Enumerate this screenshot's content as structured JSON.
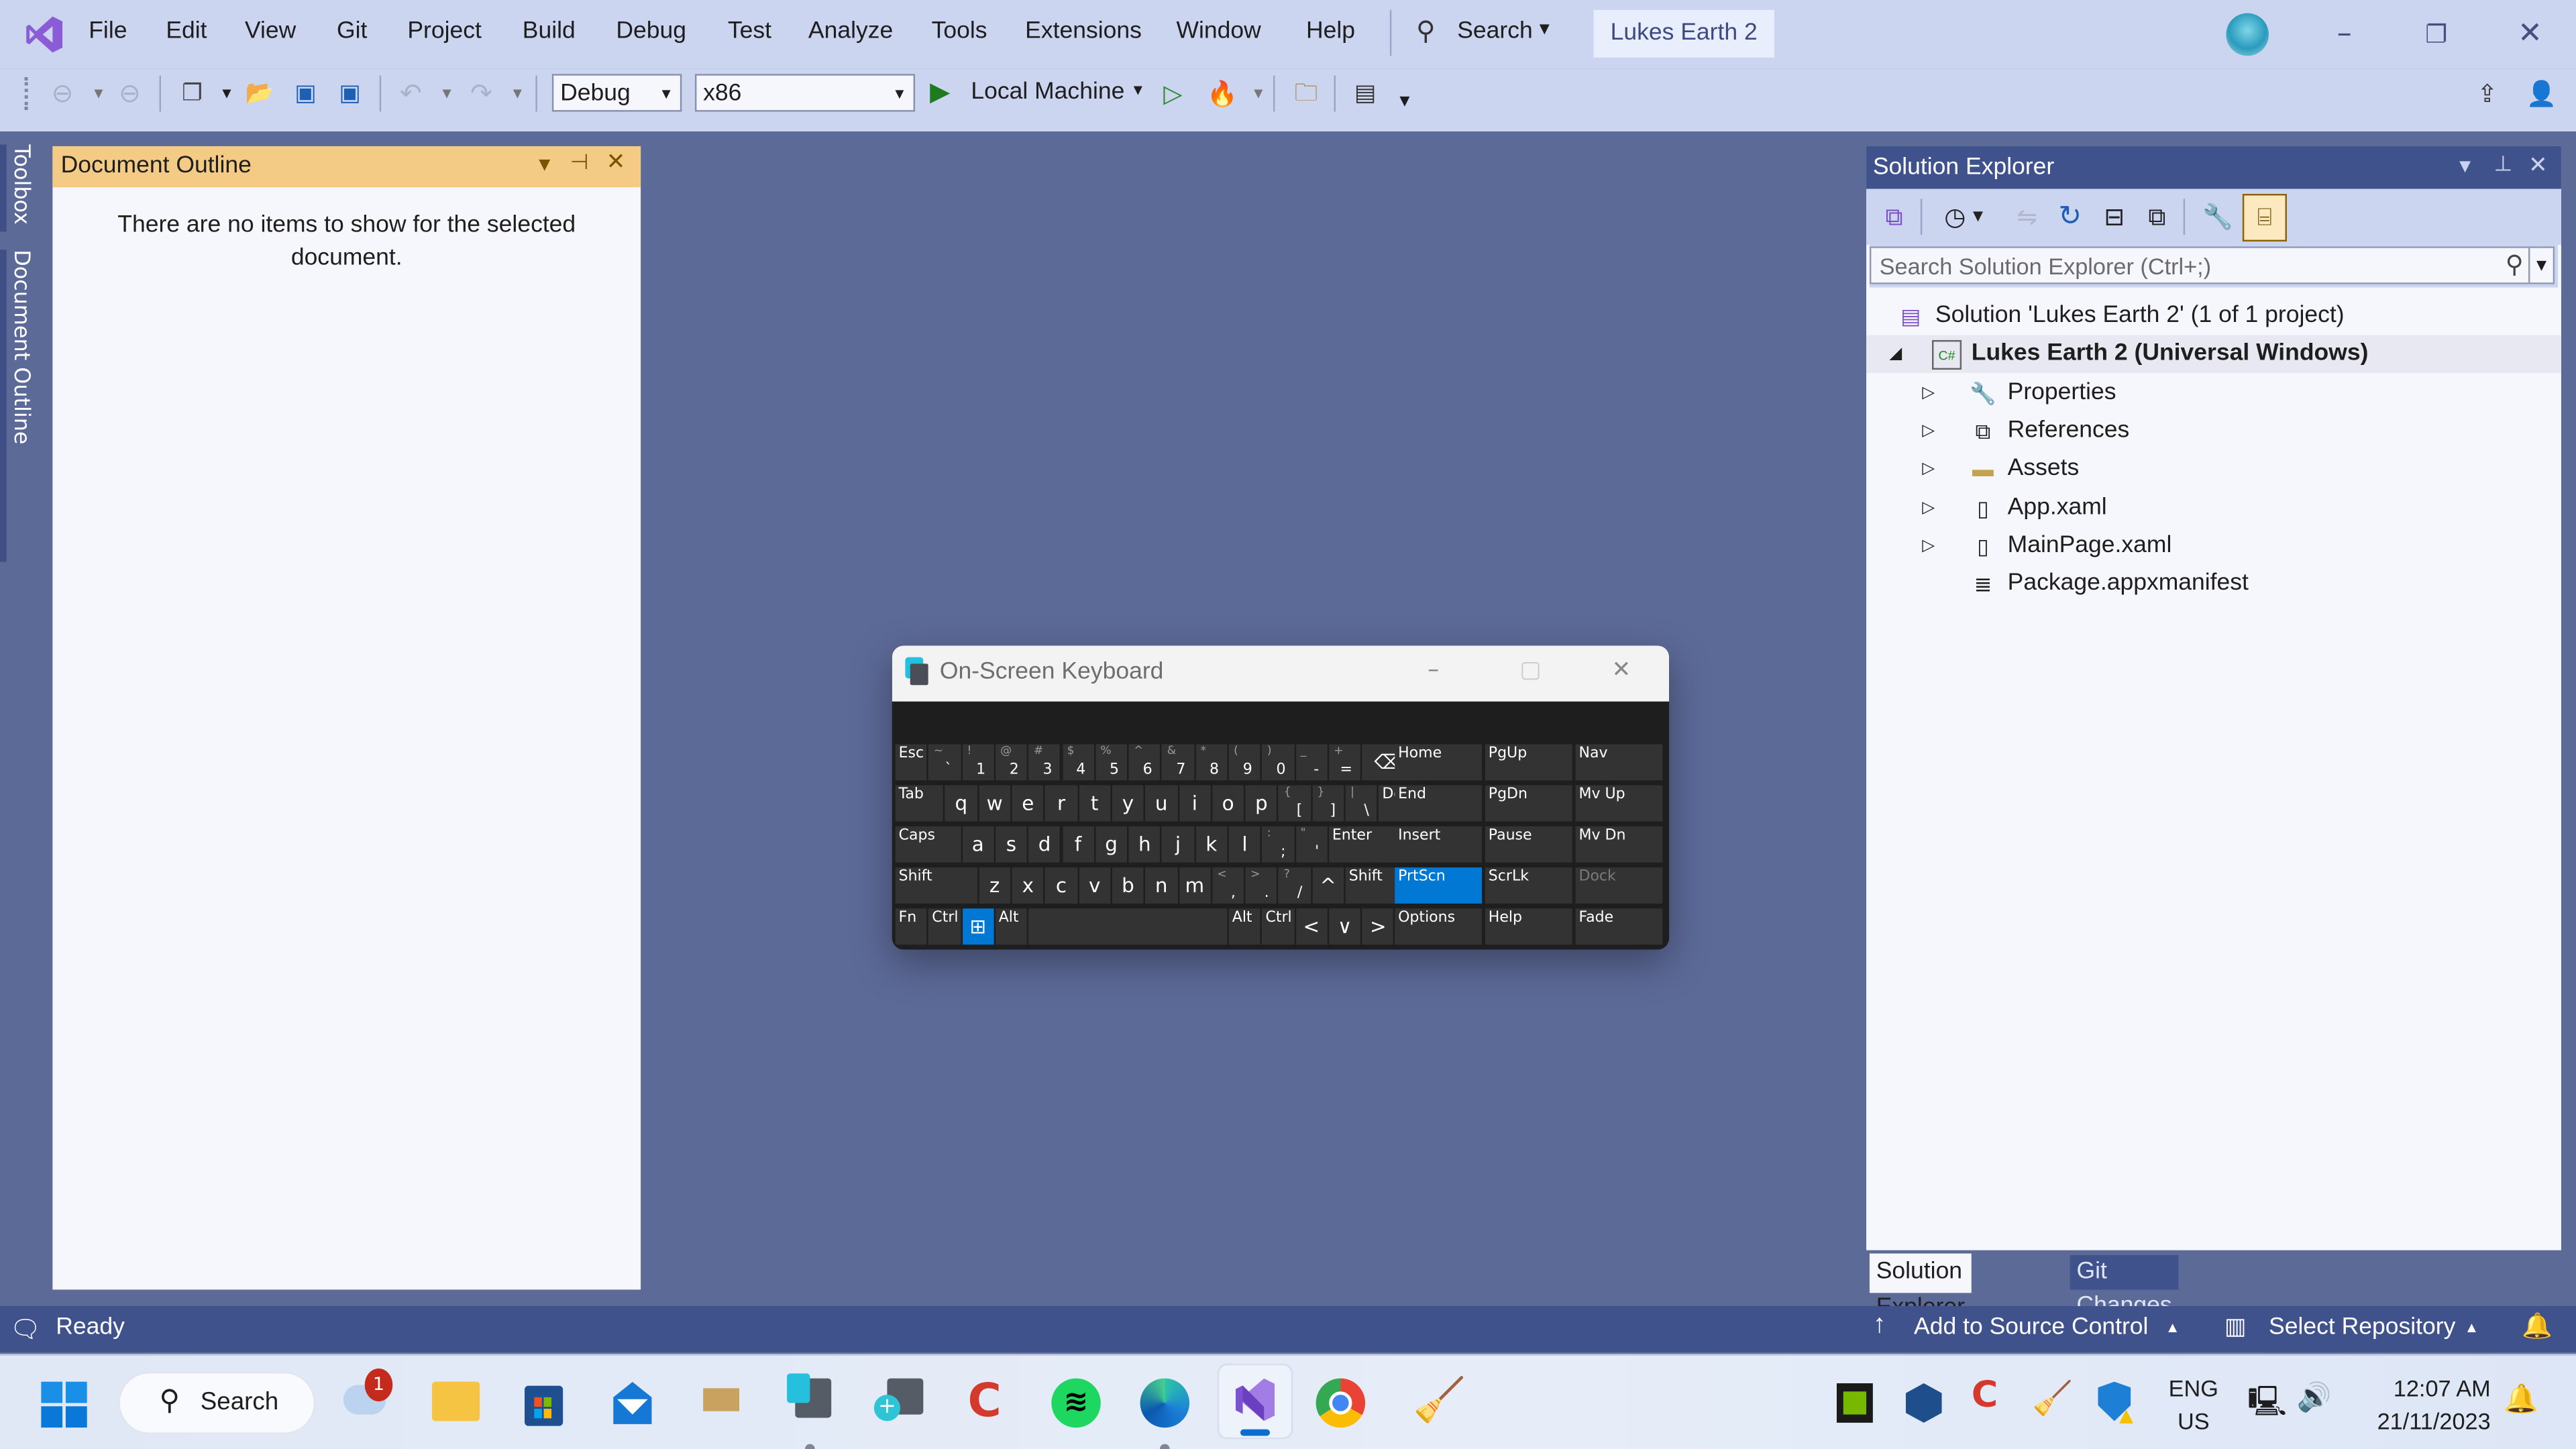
{
  "window": {
    "title": "Lukes Earth 2",
    "menu": [
      "File",
      "Edit",
      "View",
      "Git",
      "Project",
      "Build",
      "Debug",
      "Test",
      "Analyze",
      "Tools",
      "Extensions",
      "Window",
      "Help"
    ],
    "search_label": "Search",
    "controls": {
      "minimize": "–",
      "restore": "❐",
      "close": "✕"
    }
  },
  "toolbar": {
    "configuration": "Debug",
    "platform": "x86",
    "run_target": "Local Machine"
  },
  "side_tabs": {
    "toolbox": "Toolbox",
    "document_outline": "Document Outline"
  },
  "document_outline": {
    "title": "Document Outline",
    "message": "There are no items to show for the selected document."
  },
  "solution_explorer": {
    "title": "Solution Explorer",
    "search_placeholder": "Search Solution Explorer (Ctrl+;)",
    "tree": [
      {
        "label": "Solution 'Lukes Earth 2' (1 of 1 project)",
        "icon": "solution-icon",
        "level": 0,
        "expander": ""
      },
      {
        "label": "Lukes Earth 2 (Universal Windows)",
        "icon": "csharp-project-icon",
        "level": 0,
        "expander": "◢",
        "bold": true,
        "selected": true
      },
      {
        "label": "Properties",
        "icon": "wrench-icon",
        "level": 1,
        "expander": "▷"
      },
      {
        "label": "References",
        "icon": "references-icon",
        "level": 1,
        "expander": "▷"
      },
      {
        "label": "Assets",
        "icon": "folder-icon",
        "level": 1,
        "expander": "▷"
      },
      {
        "label": "App.xaml",
        "icon": "xaml-file-icon",
        "level": 1,
        "expander": "▷"
      },
      {
        "label": "MainPage.xaml",
        "icon": "xaml-file-icon",
        "level": 1,
        "expander": "▷"
      },
      {
        "label": "Package.appxmanifest",
        "icon": "manifest-icon",
        "level": 1,
        "expander": ""
      }
    ],
    "bottom_tabs": [
      "Solution Explorer",
      "Git Changes"
    ]
  },
  "statusbar": {
    "status": "Ready",
    "source_control": "Add to Source Control",
    "repository": "Select Repository"
  },
  "osk": {
    "title": "On-Screen Keyboard",
    "highlight_color": "#0078d4",
    "rows": [
      [
        [
          "Esc",
          ""
        ],
        [
          "`",
          "~"
        ],
        [
          "1",
          "!"
        ],
        [
          "2",
          "@"
        ],
        [
          "3",
          "#"
        ],
        [
          "4",
          "$"
        ],
        [
          "5",
          "%"
        ],
        [
          "6",
          "^"
        ],
        [
          "7",
          "&"
        ],
        [
          "8",
          "*"
        ],
        [
          "9",
          "("
        ],
        [
          "0",
          ")"
        ],
        [
          "-",
          "_"
        ],
        [
          "=",
          "+"
        ],
        [
          "⌫",
          ""
        ]
      ],
      [
        [
          "Tab",
          ""
        ],
        [
          "q",
          ""
        ],
        [
          "w",
          ""
        ],
        [
          "e",
          ""
        ],
        [
          "r",
          ""
        ],
        [
          "t",
          ""
        ],
        [
          "y",
          ""
        ],
        [
          "u",
          ""
        ],
        [
          "i",
          ""
        ],
        [
          "o",
          ""
        ],
        [
          "p",
          ""
        ],
        [
          "[",
          "{"
        ],
        [
          "]",
          "}"
        ],
        [
          "\\",
          "|"
        ],
        [
          "Del",
          ""
        ]
      ],
      [
        [
          "Caps",
          ""
        ],
        [
          "a",
          ""
        ],
        [
          "s",
          ""
        ],
        [
          "d",
          ""
        ],
        [
          "f",
          ""
        ],
        [
          "g",
          ""
        ],
        [
          "h",
          ""
        ],
        [
          "j",
          ""
        ],
        [
          "k",
          ""
        ],
        [
          "l",
          ""
        ],
        [
          ";",
          ":"
        ],
        [
          "'",
          "\""
        ],
        [
          "Enter",
          ""
        ]
      ],
      [
        [
          "Shift",
          ""
        ],
        [
          "z",
          ""
        ],
        [
          "x",
          ""
        ],
        [
          "c",
          ""
        ],
        [
          "v",
          ""
        ],
        [
          "b",
          ""
        ],
        [
          "n",
          ""
        ],
        [
          "m",
          ""
        ],
        [
          ",",
          "<"
        ],
        [
          ".",
          ">"
        ],
        [
          "/",
          "?"
        ],
        [
          "^",
          ""
        ],
        [
          "Shift",
          ""
        ]
      ],
      [
        [
          "Fn",
          ""
        ],
        [
          "Ctrl",
          ""
        ],
        [
          "⊞",
          ""
        ],
        [
          "Alt",
          ""
        ],
        [
          "",
          ""
        ],
        [
          "Alt",
          ""
        ],
        [
          "Ctrl",
          ""
        ],
        [
          "<",
          ""
        ],
        [
          "∨",
          ""
        ],
        [
          ">",
          ""
        ],
        [
          "≣",
          ""
        ]
      ]
    ],
    "nav_keys": [
      [
        "Home",
        "PgUp",
        "Nav"
      ],
      [
        "End",
        "PgDn",
        "Mv Up"
      ],
      [
        "Insert",
        "Pause",
        "Mv Dn"
      ],
      [
        "PrtScn",
        "ScrLk",
        "Dock"
      ],
      [
        "Options",
        "Help",
        "Fade"
      ]
    ],
    "active_keys": [
      "PrtScn",
      "Win"
    ],
    "disabled_keys": [
      "Dock"
    ]
  },
  "taskbar": {
    "search_label": "Search",
    "weather_badge": "1",
    "language": {
      "line1": "ENG",
      "line2": "US"
    },
    "time": "12:07 AM",
    "date": "21/11/2023"
  }
}
